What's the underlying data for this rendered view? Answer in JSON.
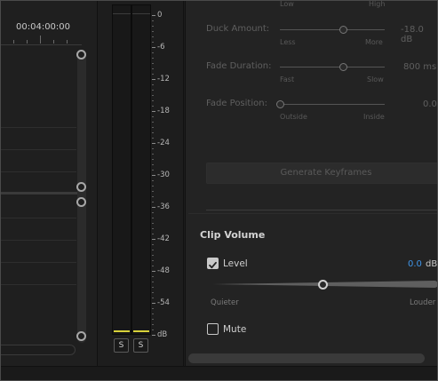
{
  "timeline": {
    "timecode": "00:04:00:00"
  },
  "meter": {
    "db_labels": [
      "0",
      "-6",
      "-12",
      "-18",
      "-24",
      "-30",
      "-36",
      "-42",
      "-48",
      "-54",
      "dB"
    ],
    "solo_left": "S",
    "solo_right": "S"
  },
  "essential_sound": {
    "top_partial": {
      "left": "Low",
      "right": "High"
    },
    "duck_amount": {
      "label": "Duck Amount:",
      "left": "Less",
      "right": "More",
      "value": "-18.0 dB"
    },
    "fade_duration": {
      "label": "Fade Duration:",
      "left": "Fast",
      "right": "Slow",
      "value": "800 ms"
    },
    "fade_position": {
      "label": "Fade Position:",
      "left": "Outside",
      "right": "Inside",
      "value": "0.0"
    },
    "generate_button": "Generate Keyframes",
    "clip_volume": {
      "title": "Clip Volume",
      "level_label": "Level",
      "level_checked": true,
      "level_value": "0.0",
      "level_unit": "dB",
      "quieter": "Quieter",
      "louder": "Louder",
      "mute_label": "Mute",
      "mute_checked": false
    }
  },
  "colors": {
    "accent_blue": "#3f95e8",
    "meter_level": "#d8d23a"
  }
}
